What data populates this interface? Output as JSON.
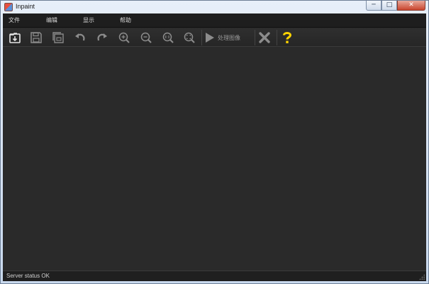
{
  "window": {
    "title": "Inpaint",
    "minimize": "─",
    "maximize": "□",
    "close": "✕"
  },
  "menu": [
    "文件",
    "编辑",
    "显示",
    "帮助"
  ],
  "toolbar": {
    "buttons": [
      "open-icon",
      "save-icon",
      "save-copy-icon",
      "undo-icon",
      "redo-icon",
      "zoom-in-icon",
      "zoom-out-icon",
      "zoom-actual-size-icon",
      "zoom-fit-icon"
    ],
    "process_label": "处理图像",
    "clear": "clear-icon",
    "help": "help-icon"
  },
  "colors": {
    "background": "#2a2a2a",
    "menubar": "#1e1e1e",
    "help_accent": "#ffd400"
  },
  "status": {
    "text": "Server status OK"
  }
}
